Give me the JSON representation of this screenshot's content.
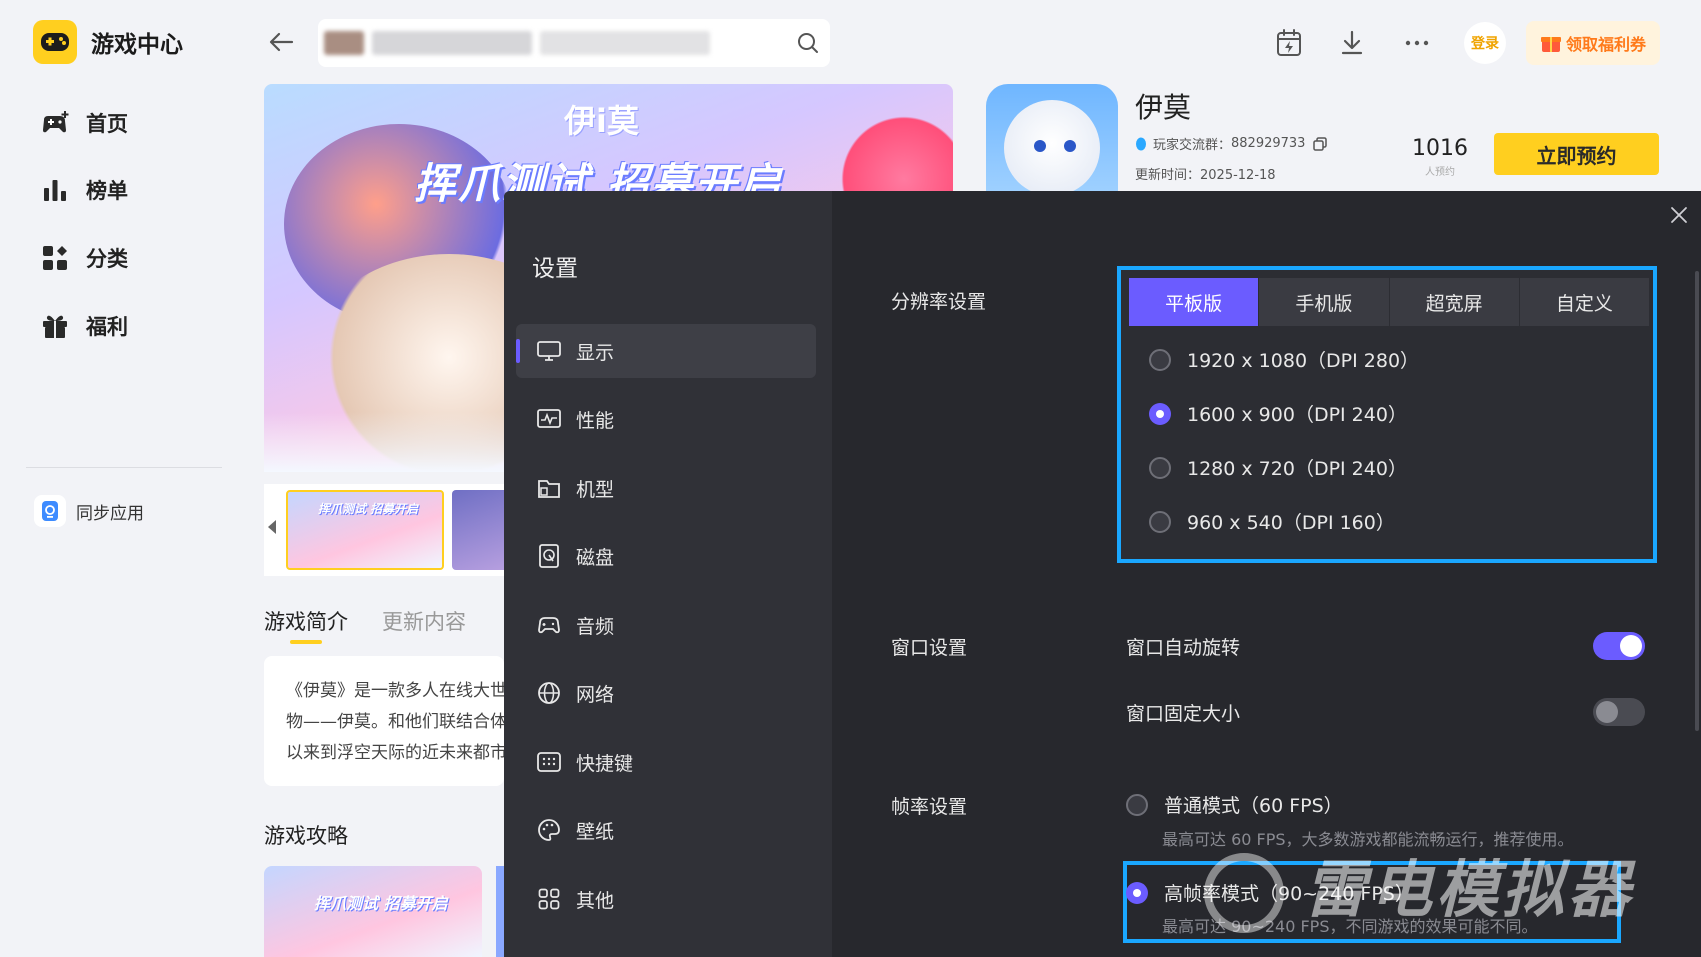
{
  "app": {
    "name": "游戏中心"
  },
  "sidebar": {
    "items": [
      {
        "label": "首页",
        "icon": "gamepad-plus-icon"
      },
      {
        "label": "榜单",
        "icon": "bar-chart-icon"
      },
      {
        "label": "分类",
        "icon": "category-grid-icon"
      },
      {
        "label": "福利",
        "icon": "gift-icon"
      }
    ],
    "sync_label": "同步应用"
  },
  "topbar": {
    "login_label": "登录",
    "coupon_label": "领取福利券"
  },
  "banner": {
    "logo_text": "伊i莫",
    "title": "挥爪测试 招募开启"
  },
  "game": {
    "name": "伊莫",
    "group_label": "玩家交流群：",
    "group_id": "882929733",
    "update_label": "更新时间：",
    "update_date": "2025-12-18",
    "reserve_count": "1016",
    "reserve_count_label": "人预约",
    "reserve_button": "立即预约"
  },
  "intro": {
    "tabs": [
      "游戏简介",
      "更新内容"
    ],
    "lines": [
      "《伊莫》是一款多人在线大世",
      "物——伊莫。和他们联结合体，",
      "以来到浮空天际的近未来都市"
    ],
    "guide_title": "游戏攻略"
  },
  "settings": {
    "title": "设置",
    "nav": [
      {
        "label": "显示",
        "icon": "monitor-icon"
      },
      {
        "label": "性能",
        "icon": "performance-icon"
      },
      {
        "label": "机型",
        "icon": "device-model-icon"
      },
      {
        "label": "磁盘",
        "icon": "disk-icon"
      },
      {
        "label": "音频",
        "icon": "audio-icon"
      },
      {
        "label": "网络",
        "icon": "globe-icon"
      },
      {
        "label": "快捷键",
        "icon": "keyboard-icon"
      },
      {
        "label": "壁纸",
        "icon": "palette-icon"
      },
      {
        "label": "其他",
        "icon": "apps-grid-icon"
      }
    ],
    "resolution": {
      "label": "分辨率设置",
      "tabs": [
        "平板版",
        "手机版",
        "超宽屏",
        "自定义"
      ],
      "active_tab": "平板版",
      "options": [
        {
          "text": "1920 x 1080（DPI 280）",
          "selected": false
        },
        {
          "text": "1600 x 900（DPI 240）",
          "selected": true
        },
        {
          "text": "1280 x 720（DPI 240）",
          "selected": false
        },
        {
          "text": "960 x 540（DPI 160）",
          "selected": false
        }
      ]
    },
    "window": {
      "label": "窗口设置",
      "auto_rotate": {
        "label": "窗口自动旋转",
        "on": true
      },
      "fixed_size": {
        "label": "窗口固定大小",
        "on": false
      }
    },
    "fps": {
      "label": "帧率设置",
      "normal": {
        "label": "普通模式（60 FPS）",
        "desc": "最高可达 60 FPS，大多数游戏都能流畅运行，推荐使用。",
        "selected": false
      },
      "high": {
        "label": "高帧率模式（90~240 FPS）",
        "desc": "最高可达 90~240 FPS，不同游戏的效果可能不同。",
        "selected": true
      }
    }
  },
  "watermark": "雷电模拟器",
  "colors": {
    "accent": "#6b5cff",
    "highlight": "#1aa7ff",
    "brand_yellow": "#ffcf1f",
    "dialog_bg": "#27282d"
  }
}
